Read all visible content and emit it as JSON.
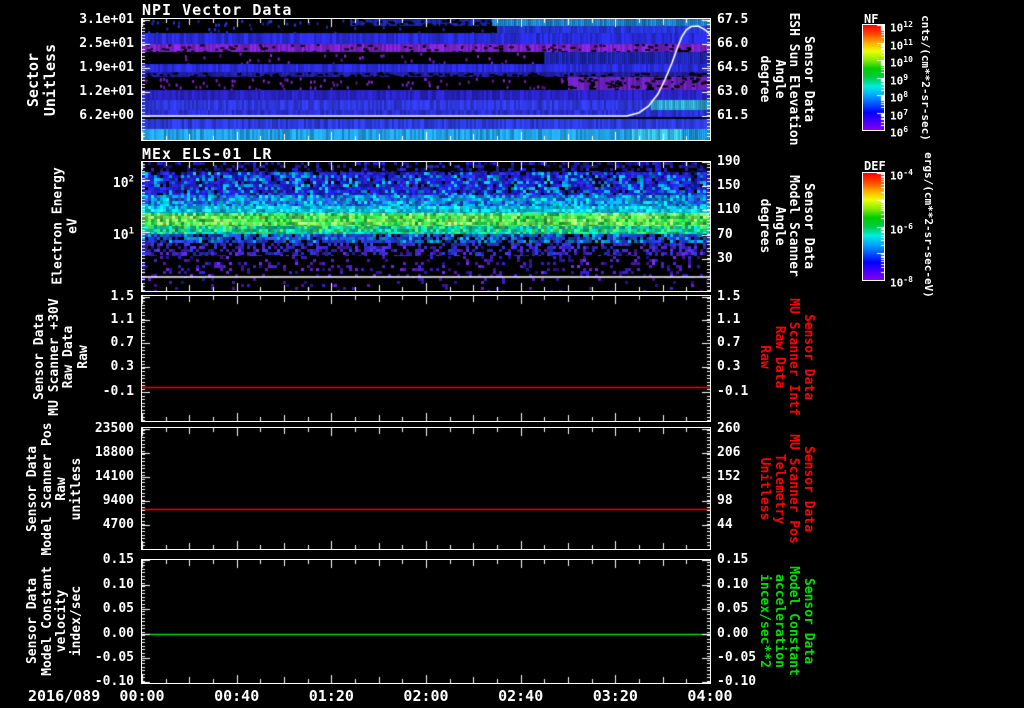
{
  "window": {
    "background": "#000000",
    "foreground": "#ffffff"
  },
  "titles": {
    "panel1": "NPI Vector Data",
    "panel2": "MEx ELS-01 LR"
  },
  "x_axis": {
    "date_label": "2016/089",
    "tick_labels": [
      "00:00",
      "00:40",
      "01:20",
      "02:00",
      "02:40",
      "03:20",
      "04:00"
    ],
    "duration_min": 240,
    "major_tick_min": 40,
    "minor_tick_min": 10
  },
  "chart_data": {
    "type": "heatmap",
    "description": "Five stacked time-series panels: NPI sector spectrogram with sun-elevation overlay, MEx ELS-01 LR electron-energy spectrogram with scanner-angle overlay, and three constant-value line panels.",
    "panels": [
      {
        "id": "npi",
        "kind": "heatmap",
        "title": "NPI Vector Data",
        "left_axis": {
          "label": "Sector\nUnitless",
          "tick_labels": [
            "3.1e+01",
            "2.5e+01",
            "1.9e+01",
            "1.2e+01",
            "6.2e+00"
          ],
          "tick_fracs": [
            0.008,
            0.207,
            0.405,
            0.603,
            0.802
          ]
        },
        "right_axis": {
          "label": "Sensor Data\nESH Sun Elevation\nAngle\ndegree",
          "color": "#ffffff",
          "tick_labels": [
            "67.5",
            "66.0",
            "64.5",
            "63.0",
            "61.5"
          ],
          "tick_fracs": [
            0.008,
            0.207,
            0.405,
            0.603,
            0.802
          ]
        },
        "overlay_line": {
          "color": "#ffffff",
          "meaning": "ESH Sun Elevation Angle: flat near 61.4 deg until ~03:25, rises to ~67.0 deg at ~03:48, eases to ~66.3 deg by 04:00",
          "points_t_frac": [
            [
              0,
              0.802
            ],
            [
              205,
              0.802
            ],
            [
              210,
              0.775
            ],
            [
              214,
              0.72
            ],
            [
              218,
              0.62
            ],
            [
              221,
              0.5
            ],
            [
              224,
              0.36
            ],
            [
              226,
              0.25
            ],
            [
              228,
              0.15
            ],
            [
              230,
              0.09
            ],
            [
              232,
              0.062
            ],
            [
              235,
              0.058
            ],
            [
              238,
              0.09
            ],
            [
              240,
              0.128
            ]
          ]
        },
        "bands": [
          {
            "y": [
              0.0,
              0.058
            ],
            "segs": [
              {
                "t": [
                  0,
                  88
                ],
                "c": null,
                "specks": {
                  "c": "#2233cc",
                  "d": 0.1
                }
              },
              {
                "t": [
                  88,
                  148
                ],
                "c": "#1a2abf",
                "black_d": 0.4
              },
              {
                "t": [
                  148,
                  240
                ],
                "c": "#1f8fe0"
              }
            ]
          },
          {
            "y": [
              0.058,
              0.116
            ],
            "segs": [
              {
                "t": [
                  0,
                  150
                ],
                "c": null,
                "specks": {
                  "c": "#2433cc",
                  "d": 0.05
                }
              },
              {
                "t": [
                  150,
                  240
                ],
                "c": "#2635d6"
              }
            ]
          },
          {
            "y": [
              0.116,
              0.207
            ],
            "segs": [
              {
                "t": [
                  0,
                  240
                ],
                "c": "#2a2ce0"
              }
            ]
          },
          {
            "y": [
              0.207,
              0.273
            ],
            "segs": [
              {
                "t": [
                  0,
                  240
                ],
                "c": "#7a22c8",
                "black_d": 0.18
              }
            ]
          },
          {
            "y": [
              0.273,
              0.372
            ],
            "segs": [
              {
                "t": [
                  0,
                  170
                ],
                "c": null,
                "specks": {
                  "c": "#7a22c8",
                  "d": 0.05
                }
              },
              {
                "t": [
                  170,
                  240
                ],
                "c": "#2228c8"
              }
            ]
          },
          {
            "y": [
              0.372,
              0.438
            ],
            "segs": [
              {
                "t": [
                  0,
                  240
                ],
                "c": "#2a2ce0"
              }
            ]
          },
          {
            "y": [
              0.438,
              0.479
            ],
            "segs": [
              {
                "t": [
                  0,
                  240
                ],
                "c": "#231f9e",
                "black_d": 0.3
              }
            ]
          },
          {
            "y": [
              0.479,
              0.587
            ],
            "segs": [
              {
                "t": [
                  0,
                  180
                ],
                "c": null,
                "specks": {
                  "c": "#7722c0",
                  "d": 0.1
                }
              },
              {
                "t": [
                  180,
                  240
                ],
                "c": "#6a1fb8",
                "black_d": 0.3
              }
            ]
          },
          {
            "y": [
              0.587,
              0.669
            ],
            "segs": [
              {
                "t": [
                  0,
                  240
                ],
                "c": "#2a24c8"
              }
            ]
          },
          {
            "y": [
              0.669,
              0.752
            ],
            "segs": [
              {
                "t": [
                  0,
                  215
                ],
                "c": "#3038e0"
              },
              {
                "t": [
                  215,
                  240
                ],
                "c": "#2fb0e0"
              }
            ]
          },
          {
            "y": [
              0.752,
              0.81
            ],
            "segs": [
              {
                "t": [
                  0,
                  240
                ],
                "c": "#2a30d4"
              }
            ]
          },
          {
            "y": [
              0.826,
              0.909
            ],
            "segs": [
              {
                "t": [
                  0,
                  240
                ],
                "c": "#2d3bdd"
              }
            ]
          },
          {
            "y": [
              0.909,
              1.0
            ],
            "segs": [
              {
                "t": [
                  0,
                  207
                ],
                "c": "#22a0e4"
              },
              {
                "t": [
                  207,
                  228
                ],
                "c": "#3cc4f0"
              },
              {
                "t": [
                  228,
                  240
                ],
                "c": "#22a0e4"
              }
            ]
          }
        ]
      },
      {
        "id": "els",
        "kind": "noise-heatmap",
        "title": "MEx ELS-01 LR",
        "left_axis": {
          "label": "Electron Energy\neV",
          "tick_exponents": [
            "2",
            "1"
          ],
          "tick_base": "10",
          "tick_fracs": [
            0.14,
            0.543
          ]
        },
        "right_axis": {
          "label": "Sensor Data\nModel Scanner\nAngle\ndegrees",
          "color": "#ffffff",
          "tick_labels": [
            "190",
            "150",
            "110",
            "70",
            "30"
          ],
          "tick_fracs": [
            0.0,
            0.186,
            0.372,
            0.566,
            0.752
          ]
        },
        "overlay_line": {
          "color": "#ffffff",
          "meaning": "Model Scanner Angle constant near 0 degrees",
          "points_t_frac": [
            [
              0,
              0.891
            ],
            [
              240,
              0.891
            ]
          ]
        },
        "noise_bands": [
          {
            "y": [
              0.0,
              0.078
            ],
            "colors": [
              "#1a1acc",
              "#222299",
              "#0f0f77"
            ],
            "d": 0.4
          },
          {
            "y": [
              0.078,
              0.256
            ],
            "colors": [
              "#2020d8",
              "#1818b0",
              "#2a2ae8",
              "#00aaee"
            ],
            "d": 0.93
          },
          {
            "y": [
              0.256,
              0.341
            ],
            "colors": [
              "#2266ee",
              "#00aaee",
              "#2244dd",
              "#00ccee"
            ],
            "d": 1.0
          },
          {
            "y": [
              0.341,
              0.395
            ],
            "colors": [
              "#00c8e0",
              "#22ddee",
              "#00aaee"
            ],
            "d": 1.0
          },
          {
            "y": [
              0.395,
              0.496
            ],
            "colors": [
              "#33e044",
              "#66f055",
              "#99ff66",
              "#22cc55"
            ],
            "d": 1.0
          },
          {
            "y": [
              0.496,
              0.558
            ],
            "colors": [
              "#22cc77",
              "#00bbaa",
              "#44dd66",
              "#00ccbb"
            ],
            "d": 1.0
          },
          {
            "y": [
              0.558,
              0.628
            ],
            "colors": [
              "#2244dd",
              "#2233bb",
              "#0099cc"
            ],
            "d": 0.85
          },
          {
            "y": [
              0.628,
              0.729
            ],
            "colors": [
              "#2233cc",
              "#3322bb",
              "#5522cc"
            ],
            "d": 0.5
          },
          {
            "y": [
              0.729,
              0.899
            ],
            "colors": [
              "#4418a8",
              "#2a18b8",
              "#6622cc"
            ],
            "d": 0.2
          },
          {
            "y": [
              0.899,
              1.0
            ],
            "colors": [
              "#5518aa",
              "#3318aa"
            ],
            "d": 0.06
          }
        ]
      },
      {
        "id": "mu-scanner-raw",
        "kind": "line",
        "left_axis": {
          "label": "Sensor Data\nMU Scanner +30V\nRaw Data\nRaw",
          "tick_labels": [
            "1.5",
            "1.1",
            "0.7",
            "0.3",
            "-0.1"
          ],
          "tick_fracs": [
            0.008,
            0.192,
            0.376,
            0.568,
            0.768
          ]
        },
        "right_axis": {
          "label": "Sensor Data\nMU Scanner Intf\nRaw Data\nRaw",
          "color": "#ff0000",
          "tick_labels": [
            "1.5",
            "1.1",
            "0.7",
            "0.3",
            "-0.1"
          ],
          "tick_fracs": [
            0.008,
            0.192,
            0.376,
            0.568,
            0.768
          ]
        },
        "line": {
          "color": "#ff0000",
          "value": 0.0,
          "y_frac": 0.728
        }
      },
      {
        "id": "model-scanner-pos",
        "kind": "line",
        "left_axis": {
          "label": "Sensor Data\nModel Scanner Pos\nRaw\nunitless",
          "tick_labels": [
            "23500",
            "18800",
            "14100",
            "9400",
            "4700"
          ],
          "tick_fracs": [
            0.008,
            0.207,
            0.405,
            0.603,
            0.802
          ]
        },
        "right_axis": {
          "label": "Sensor Data\nMU Scanner Pos\nTelemetry\nUnitless",
          "color": "#ff0000",
          "tick_labels": [
            "260",
            "206",
            "152",
            "98",
            "44"
          ],
          "tick_fracs": [
            0.008,
            0.207,
            0.405,
            0.603,
            0.802
          ]
        },
        "line": {
          "color": "#ff0000",
          "value": 8200,
          "y_frac": 0.669
        }
      },
      {
        "id": "model-constant",
        "kind": "line",
        "left_axis": {
          "label": "Sensor Data\nModel Constant\nvelocity\nindex/sec",
          "tick_labels": [
            "0.15",
            "0.10",
            "0.05",
            "0.00",
            "-0.05",
            "-0.10"
          ],
          "tick_fracs": [
            0.0,
            0.203,
            0.398,
            0.602,
            0.797,
            0.992
          ]
        },
        "right_axis": {
          "label": "Sensor Data\nModel Constant\nacceleration\nincex/sec**2",
          "color": "#00e000",
          "tick_labels": [
            "0.15",
            "0.10",
            "0.05",
            "0.00",
            "-0.05",
            "-0.10"
          ],
          "tick_fracs": [
            0.0,
            0.203,
            0.398,
            0.602,
            0.797,
            0.992
          ]
        },
        "line": {
          "color": "#00e000",
          "value": 0.0,
          "y_frac": 0.602
        }
      }
    ],
    "colorbars": [
      {
        "label": "NF",
        "units": "cnts/(cm**2-sr-sec)",
        "tick_base": "10",
        "tick_exponents": [
          "12",
          "11",
          "10",
          "9",
          "8",
          "7",
          "6"
        ],
        "gradient_bottom_to_top": [
          "#8800ee",
          "#4400ff",
          "#0000ff",
          "#0055ff",
          "#00aaff",
          "#00eedd",
          "#00cc44",
          "#00cc00",
          "#88ee00",
          "#eeff00",
          "#ffaa00",
          "#ff4400",
          "#ff0000"
        ]
      },
      {
        "label": "DEF",
        "units": "ergs/(cm**2-sr-sec-eV)",
        "tick_base": "10",
        "tick_exponents": [
          "-4",
          "-6",
          "-8"
        ],
        "gradient_bottom_to_top": [
          "#8800ee",
          "#4400ff",
          "#0000ff",
          "#0055ff",
          "#00aaff",
          "#00eedd",
          "#00cc44",
          "#00cc00",
          "#88ee00",
          "#eeff00",
          "#ffaa00",
          "#ff4400",
          "#ff0000"
        ]
      }
    ]
  }
}
